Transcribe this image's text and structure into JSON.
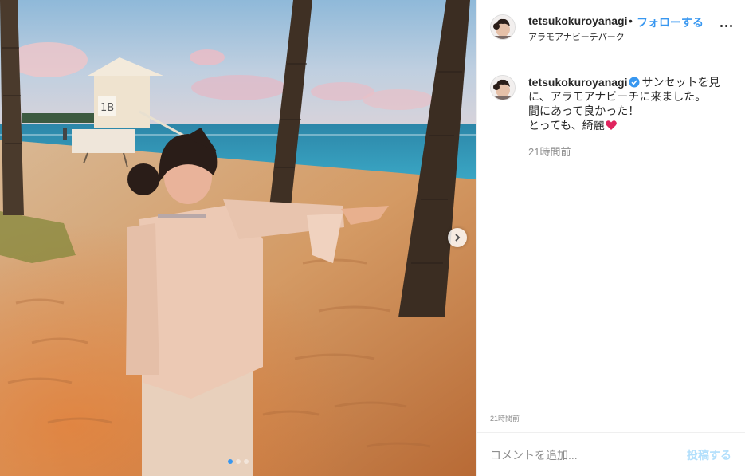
{
  "post": {
    "username": "tetsukokuroyanagi",
    "separator": "•",
    "follow_label": "フォローする",
    "location": "アラモアナビーチパーク",
    "caption_username": "tetsukokuroyanagi",
    "caption_line1": "サンセットを見",
    "caption_line2": "に、アラモアナビーチに来ました。",
    "caption_line3": "間にあって良かった！",
    "caption_line4": "とっても、綺麗",
    "caption_time": "21時間前",
    "post_time": "21時間前",
    "comment_placeholder": "コメントを追加...",
    "post_button": "投稿する",
    "photo_lifeguard_sign": "1B"
  },
  "carousel": {
    "total": 3,
    "active": 1
  },
  "colors": {
    "accent": "#3897f0",
    "disabled_post": "#b2dffc",
    "muted_text": "#8e8e8e",
    "heart": "#e0245e"
  },
  "icons": {
    "more": "ellipsis-icon",
    "next": "chevron-right-icon",
    "verified": "verified-badge-icon",
    "heart": "heart-emoji-icon"
  }
}
